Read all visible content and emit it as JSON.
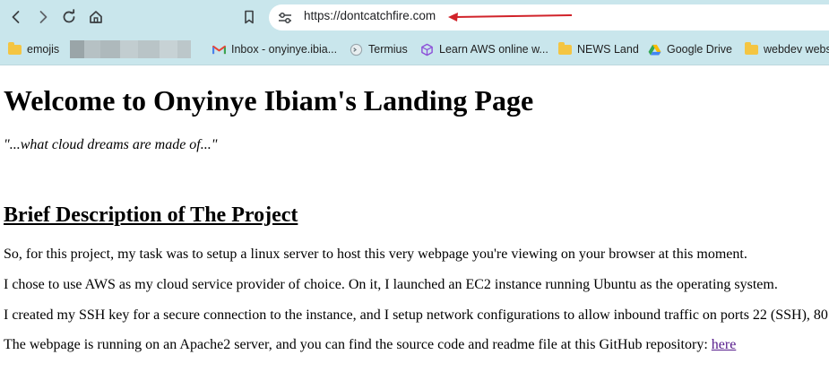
{
  "browser": {
    "url": "https://dontcatchfire.com",
    "bookmarks": [
      {
        "label": "emojis",
        "icon": "folder-icon"
      },
      {
        "label": "Inbox - onyinye.ibia...",
        "icon": "gmail-icon"
      },
      {
        "label": "Termius",
        "icon": "termius-icon"
      },
      {
        "label": "Learn AWS online w...",
        "icon": "aws-cube-icon"
      },
      {
        "label": "NEWS Land",
        "icon": "folder-icon"
      },
      {
        "label": "Google Drive",
        "icon": "google-drive-icon"
      },
      {
        "label": "webdev websi",
        "icon": "folder-icon"
      }
    ]
  },
  "page": {
    "title": "Welcome to Onyinye Ibiam's Landing Page",
    "tagline": "\"...what cloud dreams are made of...\"",
    "section_heading": "Brief Description of The Project",
    "paragraphs": [
      "So, for this project, my task was to setup a linux server to host this very webpage you're viewing on your browser at this moment.",
      "I chose to use AWS as my cloud service provider of choice. On it, I launched an EC2 instance running Ubuntu as the operating system.",
      "I created my SSH key for a secure connection to the instance, and I setup network configurations to allow inbound traffic on ports 22 (SSH), 80"
    ],
    "last_paragraph_text": "The webpage is running on an Apache2 server, and you can find the source code and readme file at this GitHub repository: ",
    "link_text": "here"
  },
  "colors": {
    "chrome_bg": "#c9e6ec",
    "annotation_arrow": "#d1232a",
    "visited_link": "#551a8b"
  }
}
